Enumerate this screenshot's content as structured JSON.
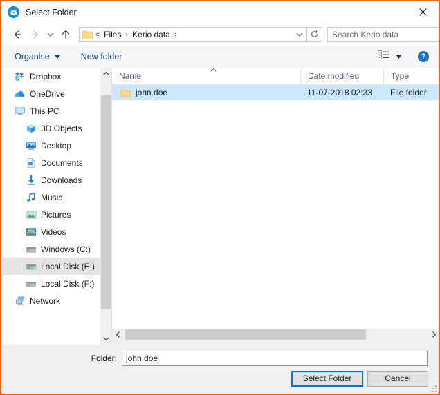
{
  "window": {
    "title": "Select Folder",
    "title_icon": "kerio-mail-icon",
    "close_icon": "close-icon",
    "border_color": "#e8640c"
  },
  "nav": {
    "back_icon": "arrow-left-icon",
    "forward_icon": "arrow-right-icon",
    "recent_icon": "chevron-down-icon",
    "up_icon": "arrow-up-icon",
    "address": {
      "folder_icon": "folder-icon",
      "prefix": "«",
      "crumbs": [
        "Files",
        "Kerio data"
      ],
      "separator": "›",
      "dropdown_icon": "chevron-down-icon",
      "refresh_icon": "refresh-icon"
    },
    "search": {
      "placeholder": "Search Kerio data",
      "value": "",
      "icon": "search-icon"
    }
  },
  "toolbar": {
    "organise_label": "Organise",
    "organise_caret_icon": "caret-down-icon",
    "new_folder_label": "New folder",
    "view_icon": "list-view-icon",
    "view_caret_icon": "caret-down-icon",
    "help_label": "?",
    "accent_color": "#15428b"
  },
  "sidebar": {
    "items": [
      {
        "label": "Dropbox",
        "icon": "dropbox-icon",
        "indent": 0,
        "selected": false
      },
      {
        "label": "OneDrive",
        "icon": "onedrive-icon",
        "indent": 0,
        "selected": false
      },
      {
        "label": "This PC",
        "icon": "this-pc-icon",
        "indent": 0,
        "selected": false
      },
      {
        "label": "3D Objects",
        "icon": "3d-objects-icon",
        "indent": 1,
        "selected": false
      },
      {
        "label": "Desktop",
        "icon": "desktop-icon",
        "indent": 1,
        "selected": false
      },
      {
        "label": "Documents",
        "icon": "documents-icon",
        "indent": 1,
        "selected": false
      },
      {
        "label": "Downloads",
        "icon": "downloads-icon",
        "indent": 1,
        "selected": false
      },
      {
        "label": "Music",
        "icon": "music-icon",
        "indent": 1,
        "selected": false
      },
      {
        "label": "Pictures",
        "icon": "pictures-icon",
        "indent": 1,
        "selected": false
      },
      {
        "label": "Videos",
        "icon": "videos-icon",
        "indent": 1,
        "selected": false
      },
      {
        "label": "Windows (C:)",
        "icon": "drive-icon",
        "indent": 1,
        "selected": false
      },
      {
        "label": "Local Disk (E:)",
        "icon": "drive-icon",
        "indent": 1,
        "selected": true
      },
      {
        "label": "Local Disk (F:)",
        "icon": "drive-icon",
        "indent": 1,
        "selected": false
      },
      {
        "label": "Network",
        "icon": "network-icon",
        "indent": 0,
        "selected": false
      }
    ],
    "scrollbar": {
      "up_icon": "chevron-up-icon",
      "down_icon": "chevron-down-icon"
    }
  },
  "filelist": {
    "columns": [
      "Name",
      "Date modified",
      "Type"
    ],
    "sort_column": "Name",
    "sort_caret_icon": "caret-up-icon",
    "rows": [
      {
        "name": "john.doe",
        "icon": "folder-icon",
        "date_modified": "11-07-2018 02:33",
        "type": "File folder",
        "selected": true
      }
    ],
    "selection_color": "#cce8ff",
    "hscroll": {
      "left_icon": "chevron-left-icon",
      "right_icon": "chevron-right-icon"
    }
  },
  "footer": {
    "folder_label": "Folder:",
    "folder_value": "john.doe",
    "select_button": "Select Folder",
    "cancel_button": "Cancel",
    "focus_color": "#0078d7",
    "resize_grip": "resize-grip-icon"
  }
}
